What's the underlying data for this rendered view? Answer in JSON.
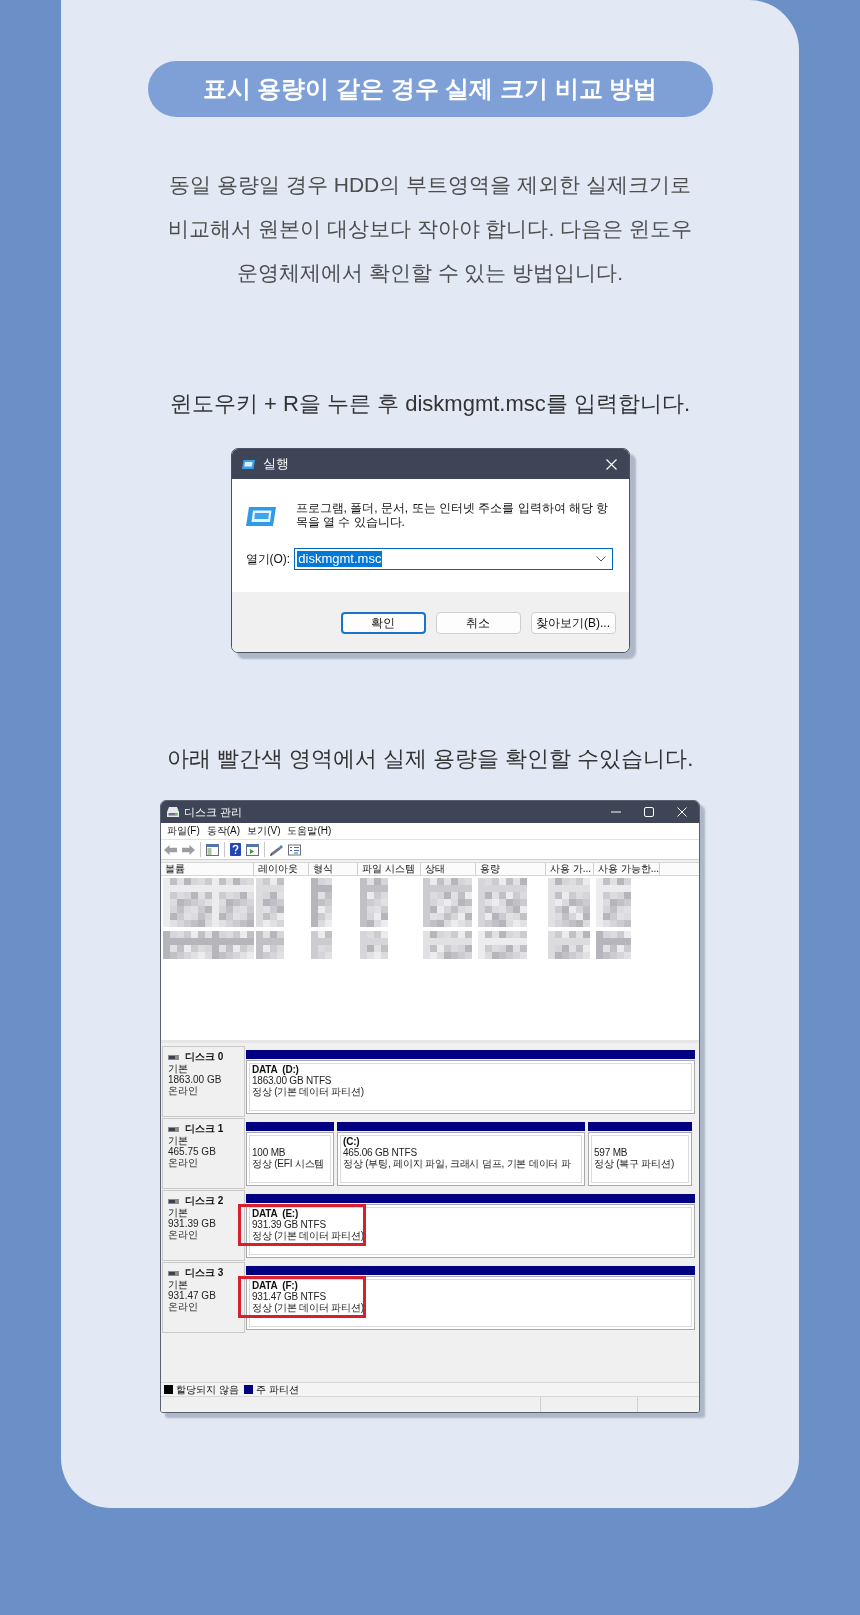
{
  "section_title": "표시 용량이 같은 경우 실제 크기 비교 방법",
  "intro_lines": [
    "동일 용량일 경우 HDD의 부트영역을 제외한 실제크기로",
    "비교해서 원본이 대상보다 작아야 합니다. 다음은 윈도우",
    "운영체제에서 확인할 수 있는 방법입니다."
  ],
  "run_step": {
    "instruction": "윈도우키 + R을 누른 후 diskmgmt.msc를 입력합니다.",
    "dialog": {
      "title": "실행",
      "message_lines": [
        "프로그램, 폴더, 문서, 또는 인터넷 주소를 입력하여 해당 항",
        "목을 열 수 있습니다."
      ],
      "open_label": "열기(O):",
      "open_value": "diskmgmt.msc",
      "value_selected": true,
      "buttons": [
        {
          "label": "확인",
          "default": true
        },
        {
          "label": "취소",
          "default": false
        },
        {
          "label": "찾아보기(B)...",
          "default": false
        }
      ]
    }
  },
  "disk_step": {
    "instruction": "아래 빨간색 영역에서 실제 용량을 확인할 수있습니다.",
    "window": {
      "title": "디스크 관리",
      "menu": [
        "파일(F)",
        "동작(A)",
        "보기(V)",
        "도움말(H)"
      ],
      "volume_columns": [
        "볼륨",
        "레이아웃",
        "형식",
        "파일 시스템",
        "상태",
        "용량",
        "사용 가...",
        "사용 가능한..."
      ],
      "disks": [
        {
          "name": "디스크 0",
          "type": "기본",
          "size": "1863.00 GB",
          "status": "온라인",
          "partitions": [
            {
              "name": "DATA  (D:)",
              "size": "1863.00 GB NTFS",
              "status": "정상 (기본 데이터 파티션)",
              "highlighted": false
            }
          ]
        },
        {
          "name": "디스크 1",
          "type": "기본",
          "size": "465.75 GB",
          "status": "온라인",
          "partitions": [
            {
              "size": "100 MB",
              "status": "정상 (EFI 시스템",
              "highlighted": false
            },
            {
              "name": "(C:)",
              "size": "465.06 GB NTFS",
              "status": "정상 (부팅, 페이지 파일, 크래시 덤프, 기본 데이터 파",
              "highlighted": false
            },
            {
              "size": "597 MB",
              "status": "정상 (복구 파티션)",
              "highlighted": false
            }
          ]
        },
        {
          "name": "디스크 2",
          "type": "기본",
          "size": "931.39 GB",
          "status": "온라인",
          "partitions": [
            {
              "name": "DATA  (E:)",
              "size": "931.39 GB NTFS",
              "status": "정상 (기본 데이터 파티션)",
              "highlighted": true
            }
          ]
        },
        {
          "name": "디스크 3",
          "type": "기본",
          "size": "931.47 GB",
          "status": "온라인",
          "partitions": [
            {
              "name": "DATA  (F:)",
              "size": "931.47 GB NTFS",
              "status": "정상 (기본 데이터 파티션)",
              "highlighted": true
            }
          ]
        }
      ],
      "legend": [
        {
          "label": "할당되지 않음",
          "color": "#000000"
        },
        {
          "label": "주 파티션",
          "color": "#000080"
        }
      ]
    }
  }
}
